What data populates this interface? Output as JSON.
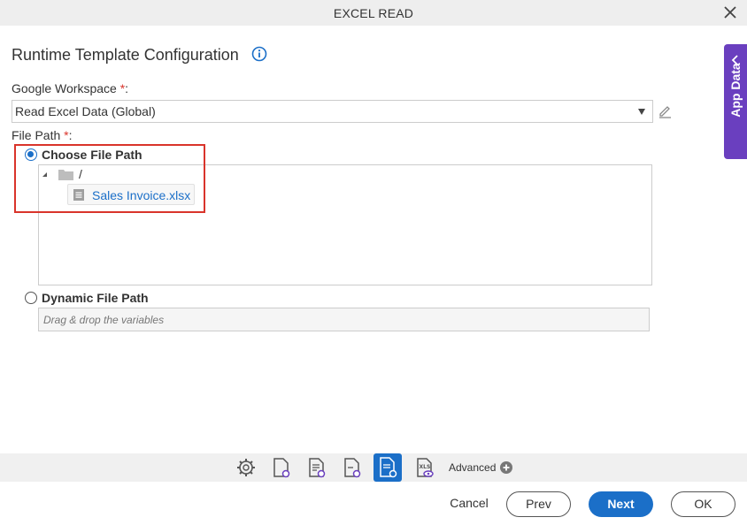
{
  "window": {
    "title": "EXCEL READ",
    "close_icon": "close-icon"
  },
  "page": {
    "heading": "Runtime Template Configuration",
    "info_icon": "info-icon"
  },
  "google_workspace": {
    "label": "Google Workspace",
    "required_marker": "*",
    "colon": ":",
    "selected_value": "Read Excel Data (Global)",
    "edit_icon": "pencil-icon"
  },
  "file_path": {
    "label": "File Path",
    "required_marker": "*",
    "colon": ":",
    "choose_option": {
      "label": "Choose File Path",
      "checked": true
    },
    "tree": {
      "root_label": "/",
      "files": [
        {
          "label": "Sales Invoice.xlsx",
          "icon": "file-icon"
        }
      ]
    },
    "dynamic_option": {
      "label": "Dynamic File Path",
      "checked": false,
      "placeholder": "Drag & drop the variables"
    }
  },
  "side_panel": {
    "label": "App Data",
    "color": "#6a3fbf"
  },
  "toolbar": {
    "icons": [
      "gear-icon",
      "file-settings-icon",
      "file-list-settings-icon",
      "file-settings-alt-icon",
      "file-active-settings-icon",
      "xls-view-icon"
    ],
    "advanced_label": "Advanced"
  },
  "footer": {
    "cancel_label": "Cancel",
    "prev_label": "Prev",
    "next_label": "Next",
    "ok_label": "OK"
  },
  "colors": {
    "accent": "#1b6fc8",
    "required": "#d9342b",
    "highlight_border": "#d9342b"
  }
}
